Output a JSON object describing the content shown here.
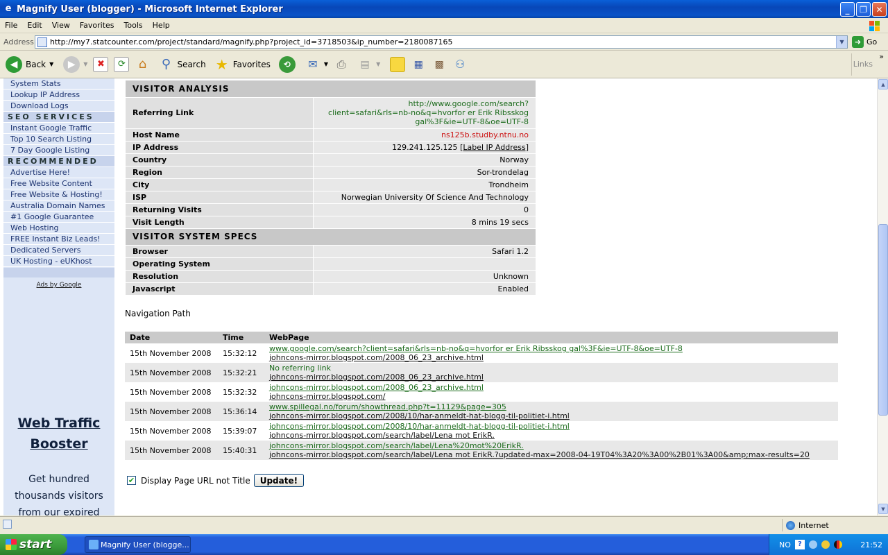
{
  "window": {
    "title": "Magnify User (blogger) - Microsoft Internet Explorer"
  },
  "menu": [
    "File",
    "Edit",
    "View",
    "Favorites",
    "Tools",
    "Help"
  ],
  "address": {
    "label": "Address",
    "url": "http://my7.statcounter.com/project/standard/magnify.php?project_id=3718503&ip_number=2180087165",
    "go": "Go"
  },
  "toolbar": {
    "back": "Back",
    "search": "Search",
    "favorites": "Favorites",
    "links": "Links",
    "more": "»"
  },
  "sidebar": {
    "links_top": [
      "System Stats",
      "Lookup IP Address",
      "Download Logs"
    ],
    "seo_header": "SEO SERVICES",
    "seo_links": [
      "Instant Google Traffic",
      "Top 10 Search Listing",
      "7 Day Google Listing"
    ],
    "rec_header": "RECOMMENDED",
    "rec_links": [
      "Advertise Here!",
      "Free Website Content",
      "Free Website & Hosting!",
      "Australia Domain Names",
      "#1 Google Guarantee",
      "Web Hosting",
      "FREE Instant Biz Leads!",
      "Dedicated Servers",
      "UK Hosting - eUKhost"
    ],
    "ads_by": "Ads by Google",
    "promo_title_1": "Web Traffic",
    "promo_title_2": "Booster",
    "promo_text_1": "Get hundred",
    "promo_text_2": "thousands visitors",
    "promo_text_3": "from our expired"
  },
  "analysis": {
    "header": "VISITOR ANALYSIS",
    "referring_label": "Referring Link",
    "referring_1": "http://www.google.com/search?",
    "referring_2": "client=safari&rls=nb-no&q=hvorfor er Erik Ribsskog",
    "referring_3": "gal%3F&ie=UTF-8&oe=UTF-8",
    "host_label": "Host Name",
    "host": "ns125b.studby.ntnu.no",
    "ip_label": "IP Address",
    "ip": "129.241.125.125",
    "ip_link": "[Label IP Address]",
    "country_label": "Country",
    "country": "Norway",
    "region_label": "Region",
    "region": "Sor-trondelag",
    "city_label": "City",
    "city": "Trondheim",
    "isp_label": "ISP",
    "isp": "Norwegian University Of Science And Technology",
    "returning_label": "Returning Visits",
    "returning": "0",
    "length_label": "Visit Length",
    "length": "8 mins 19 secs"
  },
  "specs": {
    "header": "VISITOR SYSTEM SPECS",
    "browser_label": "Browser",
    "browser": "Safari 1.2",
    "os_label": "Operating System",
    "os": "",
    "res_label": "Resolution",
    "res": "Unknown",
    "js_label": "Javascript",
    "js": "Enabled"
  },
  "nav": {
    "title": "Navigation Path",
    "headers": [
      "Date",
      "Time",
      "WebPage"
    ],
    "rows": [
      {
        "date": "15th November 2008",
        "time": "15:32:12",
        "l1": "www.google.com/search?client=safari&rls=nb-no&q=hvorfor er Erik Ribsskog gal%3F&ie=UTF-8&oe=UTF-8",
        "l2": "johncons-mirror.blogspot.com/2008_06_23_archive.html"
      },
      {
        "date": "15th November 2008",
        "time": "15:32:21",
        "l1": "No referring link",
        "l2": "johncons-mirror.blogspot.com/2008_06_23_archive.html"
      },
      {
        "date": "15th November 2008",
        "time": "15:32:32",
        "l1": "johncons-mirror.blogspot.com/2008_06_23_archive.html",
        "l2": "johncons-mirror.blogspot.com/"
      },
      {
        "date": "15th November 2008",
        "time": "15:36:14",
        "l1": "www.spillegal.no/forum/showthread.php?t=11129&page=305",
        "l2": "johncons-mirror.blogspot.com/2008/10/har-anmeldt-hat-blogg-til-politiet-i.html"
      },
      {
        "date": "15th November 2008",
        "time": "15:39:07",
        "l1": "johncons-mirror.blogspot.com/2008/10/har-anmeldt-hat-blogg-til-politiet-i.html",
        "l2": "johncons-mirror.blogspot.com/search/label/Lena mot ErikR."
      },
      {
        "date": "15th November 2008",
        "time": "15:40:31",
        "l1": "johncons-mirror.blogspot.com/search/label/Lena%20mot%20ErikR.",
        "l2": "johncons-mirror.blogspot.com/search/label/Lena mot ErikR.?updated-max=2008-04-19T04%3A20%3A00%2B01%3A00&amp;max-results=20"
      }
    ],
    "checkbox_label": "Display Page URL not Title",
    "update_button": "Update!"
  },
  "status": {
    "zone": "Internet"
  },
  "taskbar": {
    "start": "start",
    "task": "Magnify User (blogge...",
    "lang": "NO",
    "clock": "21:52"
  }
}
